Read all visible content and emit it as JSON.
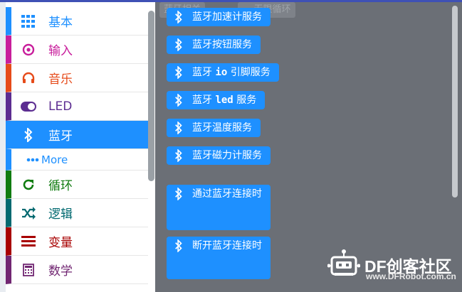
{
  "toolbox": {
    "categories": [
      {
        "label": "基本",
        "icon": "grid-icon",
        "color": "#1e90ff"
      },
      {
        "label": "输入",
        "icon": "target-icon",
        "color": "#c81d9b"
      },
      {
        "label": "音乐",
        "icon": "headphones-icon",
        "color": "#e64a19"
      },
      {
        "label": "LED",
        "icon": "toggle-icon",
        "color": "#5c2d91"
      },
      {
        "label": "蓝牙",
        "icon": "bluetooth-icon",
        "color": "#1e90ff"
      },
      {
        "label": "More",
        "icon": "dots-icon",
        "color": "#1e90ff"
      },
      {
        "label": "循环",
        "icon": "refresh-icon",
        "color": "#107c10"
      },
      {
        "label": "逻辑",
        "icon": "shuffle-icon",
        "color": "#006970"
      },
      {
        "label": "变量",
        "icon": "list-icon",
        "color": "#a80000"
      },
      {
        "label": "数学",
        "icon": "calculator-icon",
        "color": "#712672"
      }
    ]
  },
  "flyout": {
    "ghost": [
      "蓝牙相关",
      "··· 无限循环"
    ],
    "blocks": [
      "蓝牙加速计服务",
      "蓝牙按钮服务",
      [
        "蓝牙 ",
        "io",
        " 引脚服务"
      ],
      [
        "蓝牙 ",
        "led",
        " 服务"
      ],
      "蓝牙温度服务",
      "蓝牙磁力计服务"
    ],
    "events": [
      "通过蓝牙连接时",
      "断开蓝牙连接时"
    ]
  },
  "watermark": {
    "brand": "DF创客社区",
    "url": "www.DFRobot.com.cn"
  }
}
